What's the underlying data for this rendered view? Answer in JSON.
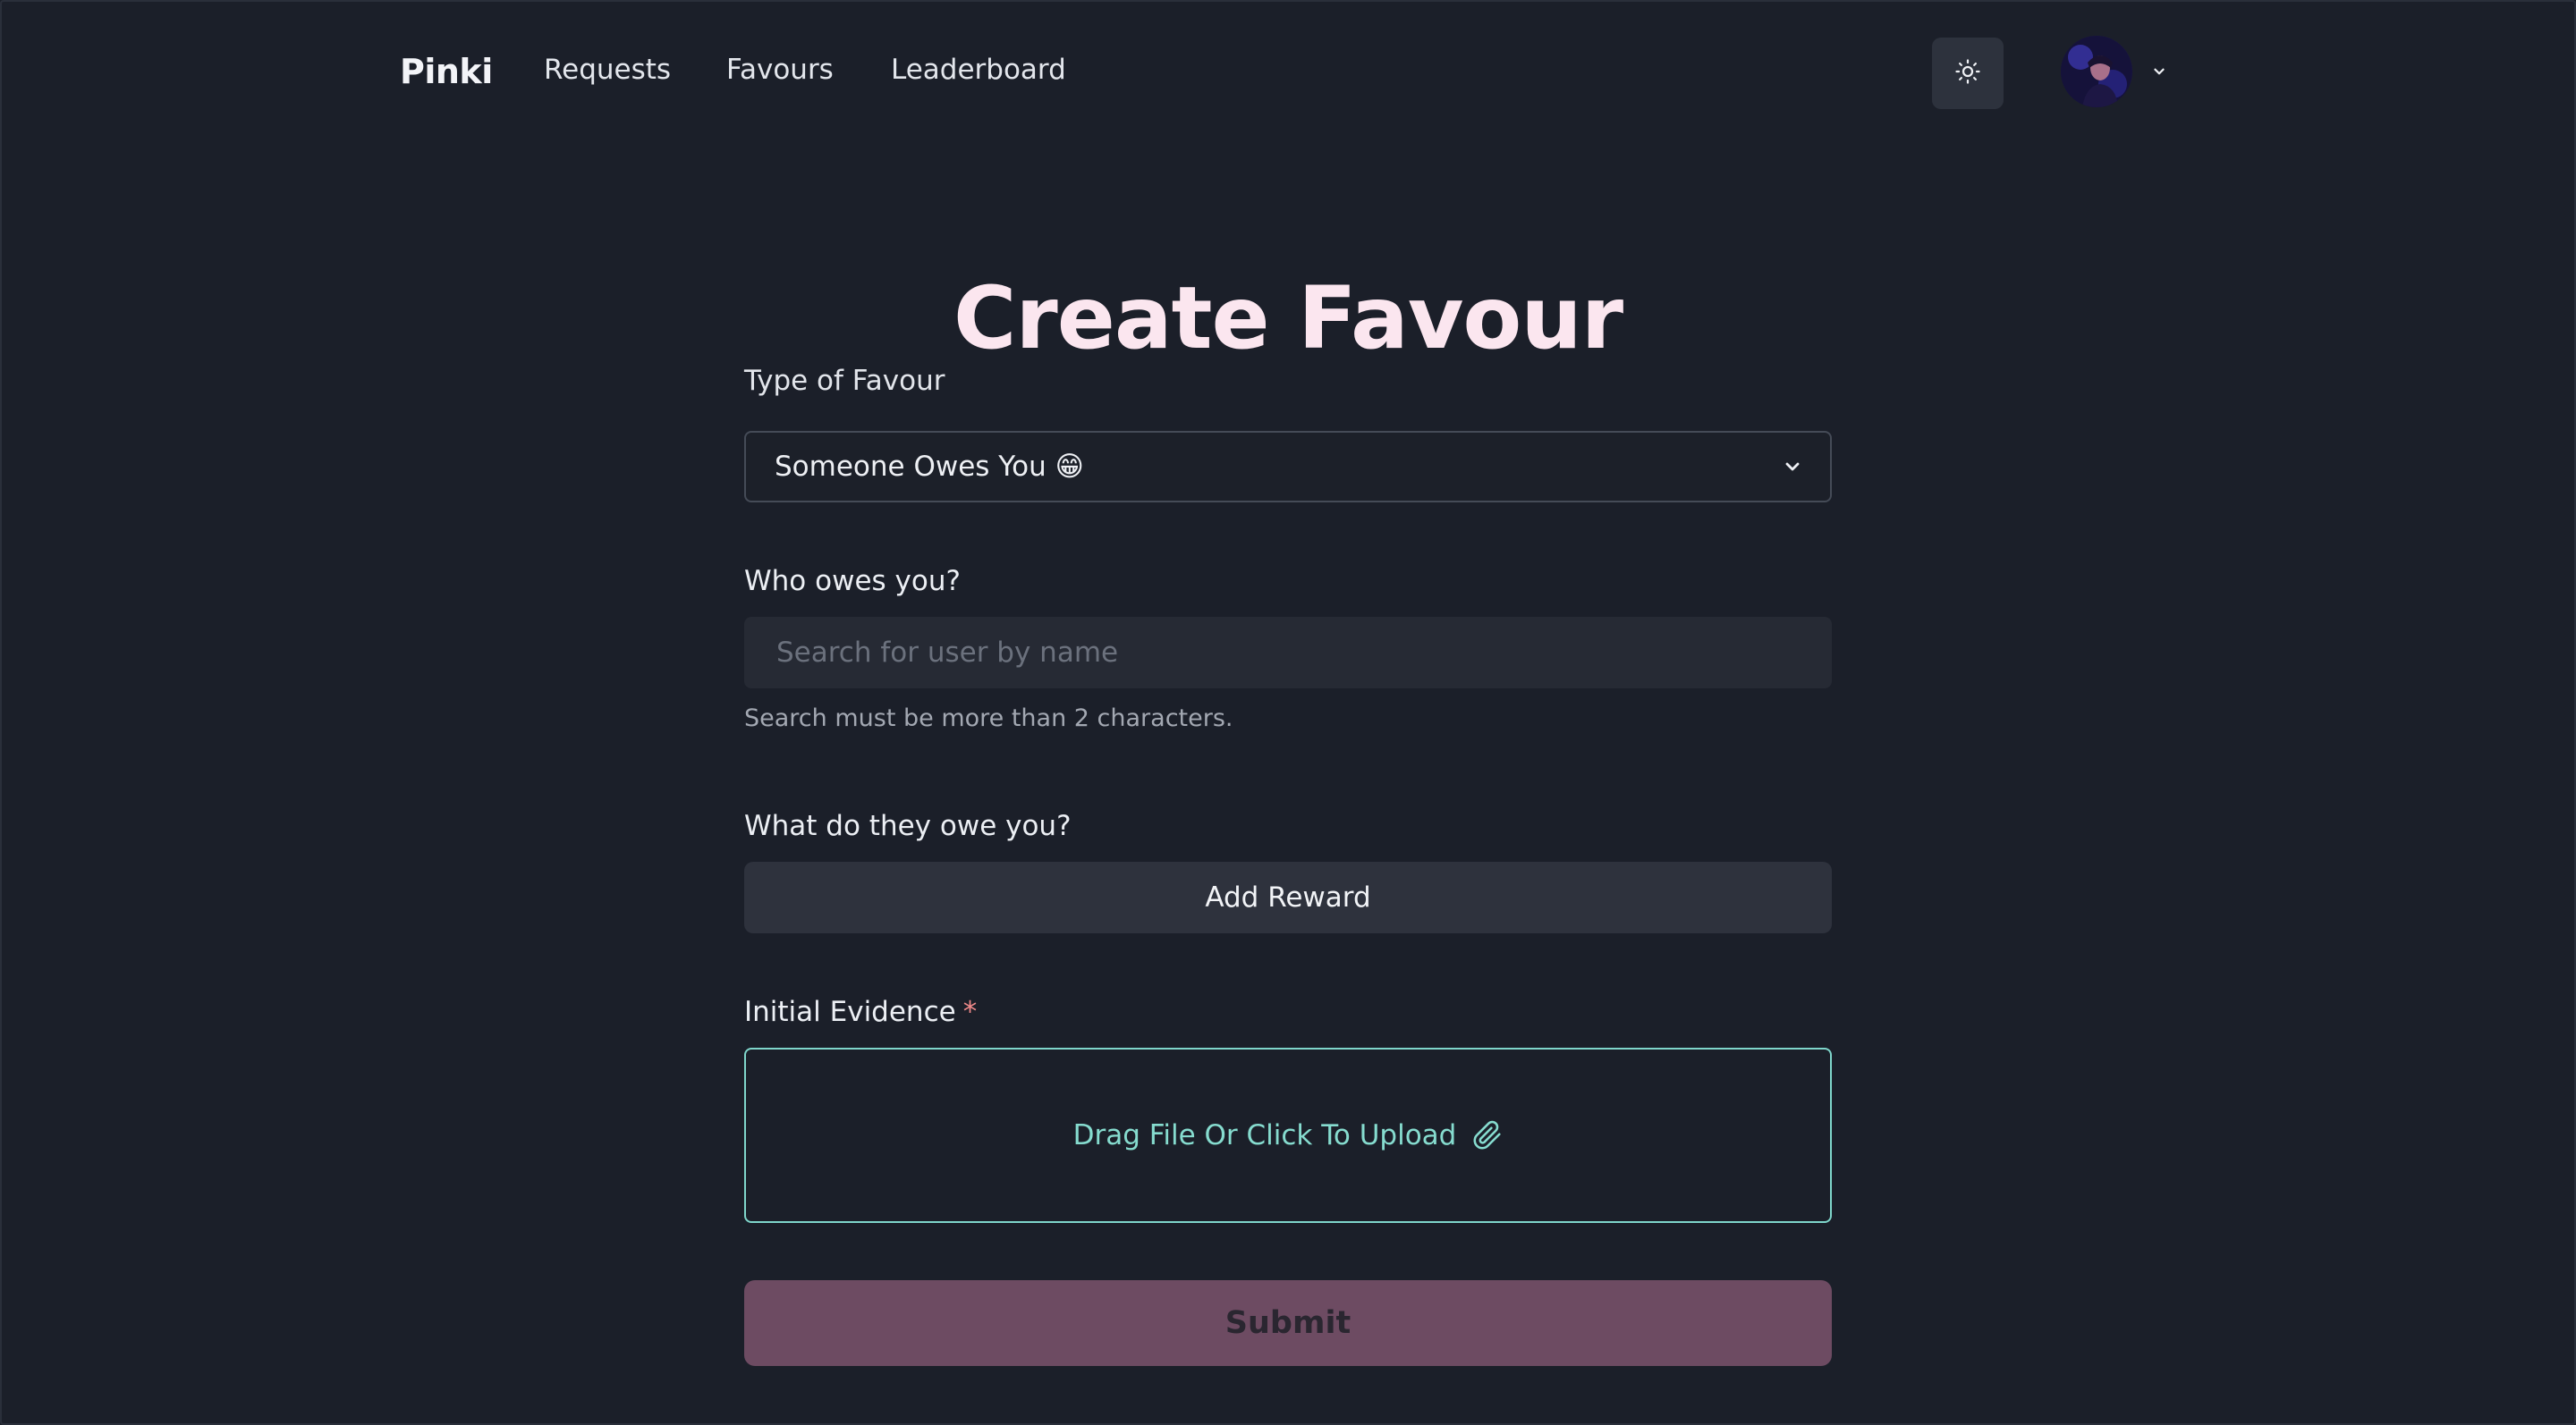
{
  "nav": {
    "brand": "Pinki",
    "links": [
      "Requests",
      "Favours",
      "Leaderboard"
    ]
  },
  "page": {
    "title": "Create Favour"
  },
  "form": {
    "type_label": "Type of Favour",
    "type_selected": "Someone Owes You 😁",
    "who_label": "Who owes you?",
    "search_placeholder": "Search for user by name",
    "search_value": "",
    "search_help": "Search must be more than 2 characters.",
    "what_label": "What do they owe you?",
    "add_reward_label": "Add Reward",
    "evidence_label": "Initial Evidence",
    "evidence_required": "*",
    "upload_label": "Drag File Or Click To Upload",
    "submit_label": "Submit"
  },
  "icons": {
    "theme_toggle": "sun-icon",
    "select_chevron": "chevron-down-icon",
    "avatar_chevron": "chevron-down-icon",
    "upload": "paperclip-icon"
  },
  "colors": {
    "background": "#1b1f29",
    "title": "#fbe6ef",
    "upload_accent": "#86dccf",
    "submit_bg": "#6d4b62",
    "required": "#f08a8a"
  }
}
